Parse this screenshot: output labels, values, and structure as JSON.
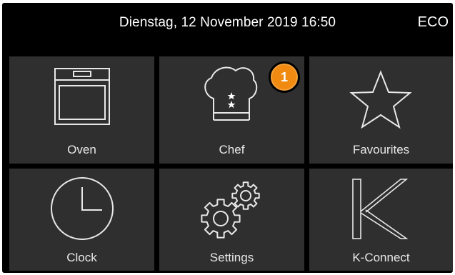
{
  "status_bar": {
    "datetime": "Dienstag, 12 November 2019 16:50",
    "mode": "ECO"
  },
  "tiles": [
    {
      "label": "Oven",
      "icon": "oven-icon"
    },
    {
      "label": "Chef",
      "icon": "chef-hat-icon"
    },
    {
      "label": "Favourites",
      "icon": "star-icon"
    },
    {
      "label": "Clock",
      "icon": "clock-icon"
    },
    {
      "label": "Settings",
      "icon": "gears-icon"
    },
    {
      "label": "K-Connect",
      "icon": "k-connect-icon"
    }
  ],
  "chef_badge": {
    "count": "1",
    "color": "#f08a10"
  },
  "colors": {
    "background": "#000000",
    "tile": "#2f2f2f",
    "text": "#ffffff"
  }
}
